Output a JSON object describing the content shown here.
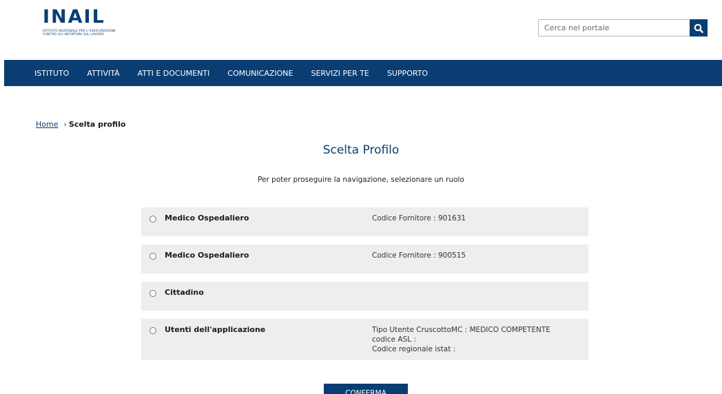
{
  "brand": {
    "logo_text": "INAIL",
    "logo_subtext": "ISTITUTO NAZIONALE PER L'ASSICURAZIONE CONTRO GLI INFORTUNI SUL LAVORO",
    "primary_color": "#0a3e73"
  },
  "search": {
    "placeholder": "Cerca nel portale",
    "icon": "search-icon"
  },
  "nav": {
    "items": [
      "ISTITUTO",
      "ATTIVITÀ",
      "ATTI E DOCUMENTI",
      "COMUNICAZIONE",
      "SERVIZI PER TE",
      "SUPPORTO"
    ]
  },
  "breadcrumb": {
    "home": "Home",
    "separator": "›",
    "current": "Scelta profilo"
  },
  "main": {
    "title": "Scelta Profilo",
    "subtitle": "Per poter proseguire la navigazione, selezionare un ruolo",
    "profiles": [
      {
        "name": "Medico Ospedaliero",
        "details": [
          "Codice Fornitore : 901631"
        ]
      },
      {
        "name": "Medico Ospedaliero",
        "details": [
          "Codice Fornitore : 900515"
        ]
      },
      {
        "name": "Cittadino",
        "details": []
      },
      {
        "name": "Utenti dell'applicazione",
        "details": [
          "Tipo Utente CruscottoMC : MEDICO COMPETENTE",
          "codice ASL :",
          "Codice regionale istat :"
        ]
      }
    ],
    "confirm_label": "CONFERMA"
  }
}
